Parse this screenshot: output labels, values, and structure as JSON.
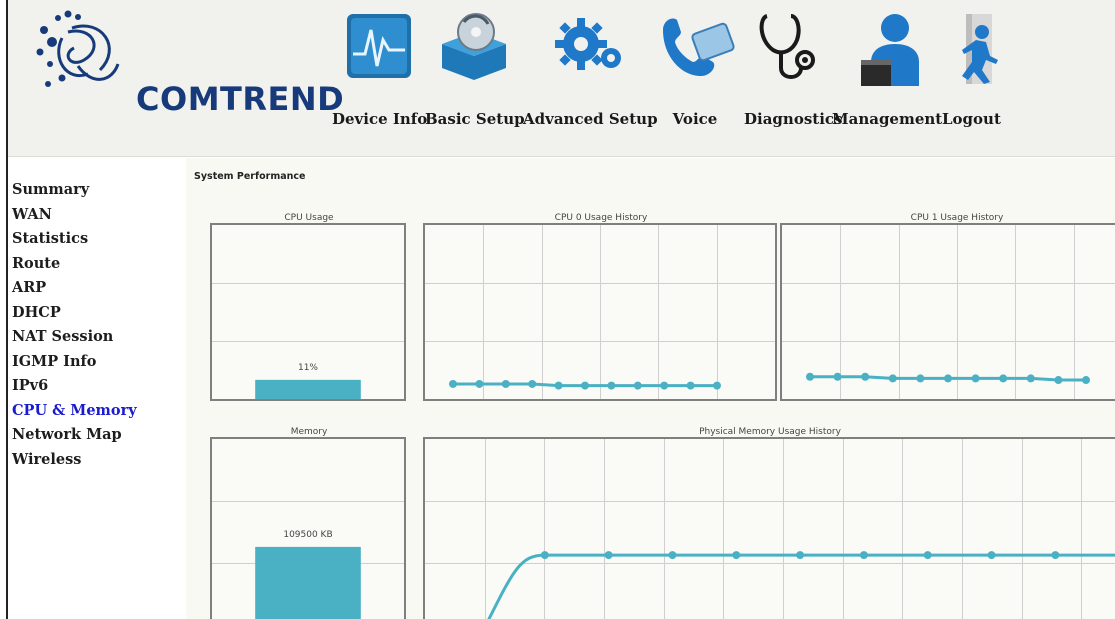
{
  "brand": {
    "name": "COMTREND"
  },
  "nav": [
    {
      "label": "Device Info",
      "icon": "device-info-icon"
    },
    {
      "label": "Basic Setup",
      "icon": "basic-setup-icon"
    },
    {
      "label": "Advanced Setup",
      "icon": "advanced-setup-icon"
    },
    {
      "label": "Voice",
      "icon": "voice-phone-icon"
    },
    {
      "label": "Diagnostics",
      "icon": "stethoscope-icon"
    },
    {
      "label": "Management",
      "icon": "management-user-icon"
    },
    {
      "label": "Logout",
      "icon": "logout-running-icon"
    }
  ],
  "sidebar": {
    "items": [
      {
        "label": "Summary"
      },
      {
        "label": "WAN"
      },
      {
        "label": "Statistics"
      },
      {
        "label": "Route"
      },
      {
        "label": "ARP"
      },
      {
        "label": "DHCP"
      },
      {
        "label": "NAT Session"
      },
      {
        "label": "IGMP Info"
      },
      {
        "label": "IPv6"
      },
      {
        "label": "CPU & Memory",
        "active": true
      },
      {
        "label": "Network Map"
      },
      {
        "label": "Wireless"
      }
    ]
  },
  "main": {
    "title": "System Performance",
    "cpu_usage": {
      "title": "CPU Usage",
      "label": "11%",
      "value_percent": 11
    },
    "cpu0_history": {
      "title": "CPU 0 Usage History"
    },
    "cpu1_history": {
      "title": "CPU 1 Usage History"
    },
    "memory": {
      "title": "Memory",
      "label": "109500 KB"
    },
    "mem_history": {
      "title": "Physical Memory Usage History"
    }
  },
  "colors": {
    "accent": "#4ab0c4",
    "active_link": "#1a1ad0",
    "brand": "#173a7a",
    "panel_border": "#7f7f7f",
    "grid": "#cfcfcf"
  },
  "chart_data": [
    {
      "type": "bar",
      "title": "CPU Usage",
      "values": [
        11
      ],
      "ylim": [
        0,
        100
      ]
    },
    {
      "type": "line",
      "title": "CPU 0 Usage History",
      "series": [
        {
          "values": [
            11,
            11,
            11,
            11,
            10,
            10,
            10,
            10,
            10,
            10,
            10
          ]
        }
      ],
      "ylim": [
        0,
        100
      ]
    },
    {
      "type": "line",
      "title": "CPU 1 Usage History",
      "series": [
        {
          "values": [
            16,
            16,
            16,
            15,
            15,
            15,
            15,
            15,
            15,
            14,
            14
          ]
        }
      ],
      "ylim": [
        0,
        100
      ]
    },
    {
      "type": "bar",
      "title": "Memory",
      "values": [
        109500
      ]
    },
    {
      "type": "line",
      "title": "Physical Memory Usage History",
      "series": [
        {
          "values": [
            0,
            109500,
            109500,
            109500,
            109500,
            109500,
            109500,
            109500,
            109500,
            109500,
            109500,
            109500
          ]
        }
      ]
    }
  ]
}
